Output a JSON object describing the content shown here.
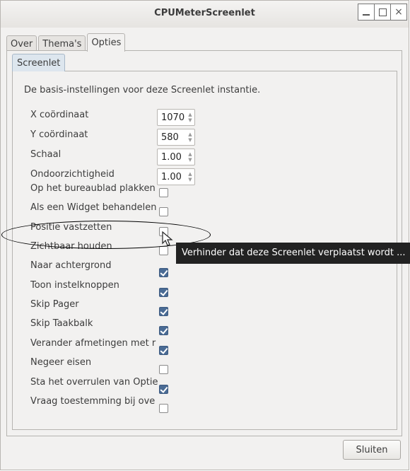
{
  "window": {
    "title": "CPUMeterScreenlet",
    "controls": {
      "minimize": "minimize",
      "maximize": "maximize",
      "close": "×"
    }
  },
  "tabs": [
    {
      "label": "Over",
      "active": false
    },
    {
      "label": "Thema's",
      "active": false
    },
    {
      "label": "Opties",
      "active": true
    }
  ],
  "subtab": {
    "label": "Screenlet"
  },
  "description": "De basis-instellingen voor deze Screenlet instantie.",
  "spin_rows": [
    {
      "label": "X coördinaat",
      "value": "1070"
    },
    {
      "label": "Y coördinaat",
      "value": "580"
    },
    {
      "label": "Schaal",
      "value": "1.00"
    },
    {
      "label": "Ondoorzichtigheid",
      "value": "1.00"
    }
  ],
  "check_rows": [
    {
      "label": "Op het bureaublad plakken",
      "checked": false
    },
    {
      "label": "Als een Widget behandelen",
      "checked": false
    },
    {
      "label": "Positie vastzetten",
      "checked": false
    },
    {
      "label": "Zichtbaar houden",
      "checked": false
    },
    {
      "label": "Naar achtergrond",
      "checked": true
    },
    {
      "label": "Toon instelknoppen",
      "checked": true
    },
    {
      "label": "Skip Pager",
      "checked": true
    },
    {
      "label": "Skip Taakbalk",
      "checked": true
    },
    {
      "label": "Verander afmetingen met r",
      "checked": true
    },
    {
      "label": "Negeer eisen",
      "checked": false
    },
    {
      "label": "Sta het overrulen van Optie",
      "checked": true
    },
    {
      "label": "Vraag toestemming bij ove",
      "checked": false
    }
  ],
  "tooltip": "Verhinder dat deze Screenlet verplaatst wordt ...",
  "buttons": {
    "close_label": "Sluiten"
  }
}
